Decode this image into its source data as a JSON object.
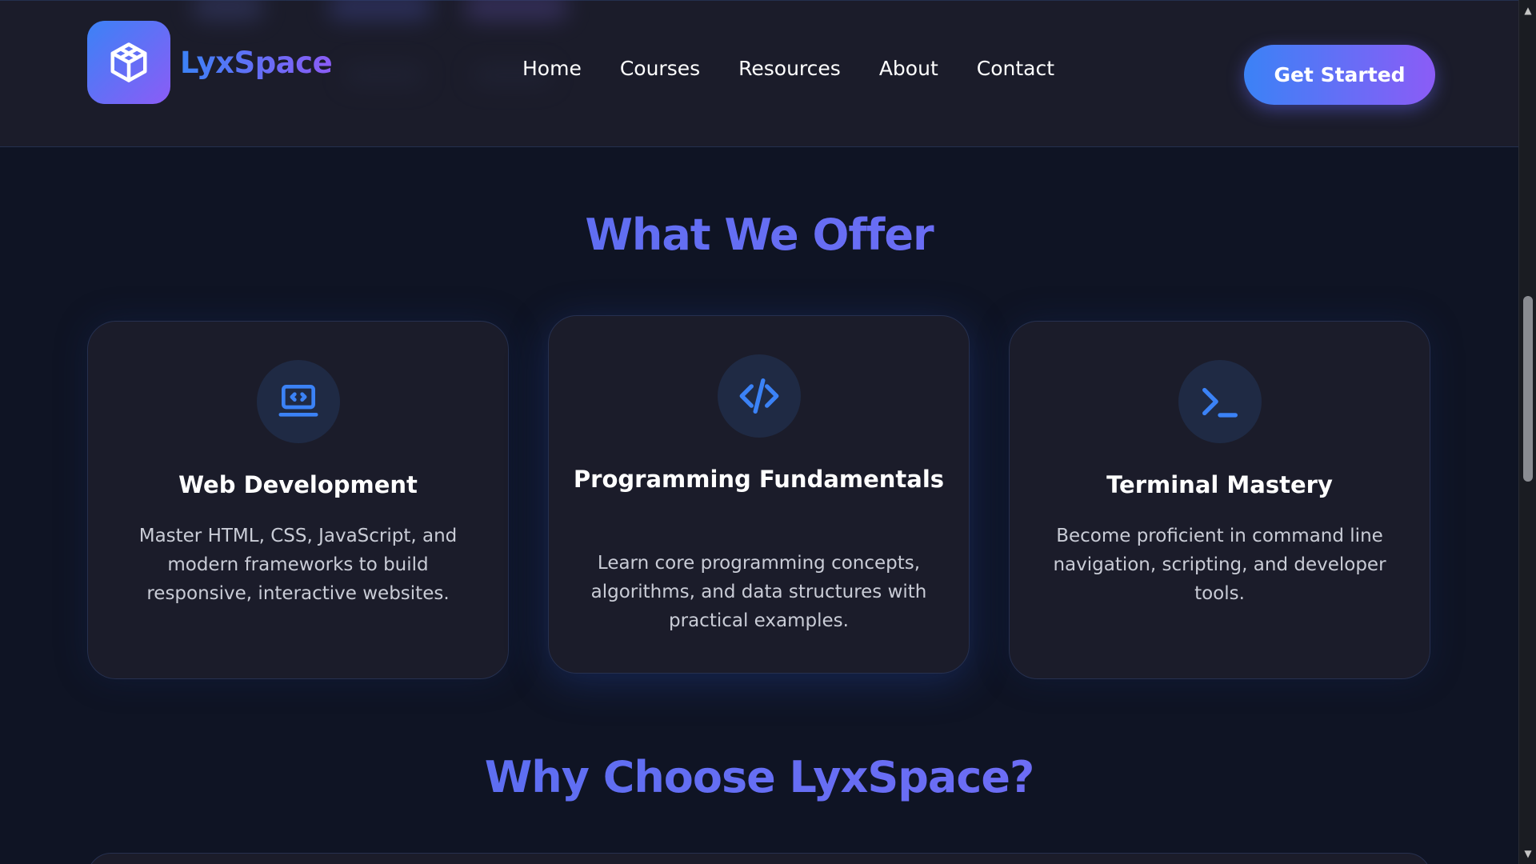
{
  "brand": {
    "name": "LyxSpace",
    "logo_icon": "cube-icon"
  },
  "nav": {
    "items": [
      {
        "label": "Home"
      },
      {
        "label": "Courses"
      },
      {
        "label": "Resources"
      },
      {
        "label": "About"
      },
      {
        "label": "Contact"
      }
    ],
    "cta_label": "Get Started"
  },
  "offer": {
    "title": "What We Offer",
    "cards": [
      {
        "icon": "laptop-code-icon",
        "title": "Web Development",
        "description": "Master HTML, CSS, JavaScript, and modern frameworks to build responsive, interactive websites."
      },
      {
        "icon": "code-icon",
        "title": "Programming Fundamentals",
        "description": "Learn core programming concepts, algorithms, and data structures with practical examples."
      },
      {
        "icon": "terminal-icon",
        "title": "Terminal Mastery",
        "description": "Become proficient in command line navigation, scripting, and developer tools."
      }
    ]
  },
  "why": {
    "title": "Why Choose LyxSpace?"
  },
  "colors": {
    "accent_blue": "#3b82f6",
    "accent_purple": "#8b5cf6",
    "background": "#0f1424",
    "card": "#1b1c2a",
    "icon_circle": "#1f2a44"
  }
}
